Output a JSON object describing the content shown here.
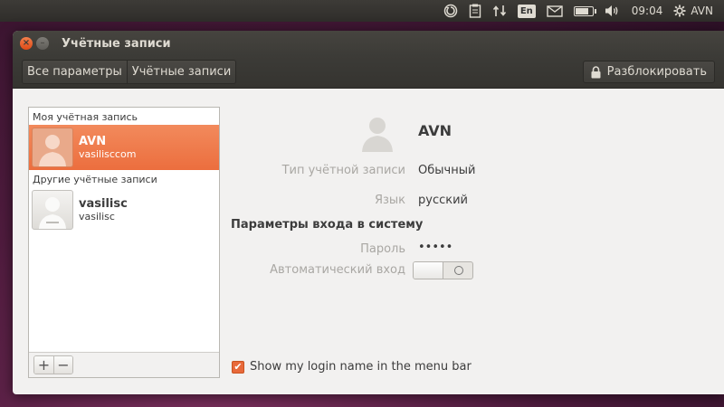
{
  "top_panel": {
    "lang": "En",
    "time": "09:04",
    "user": "AVN",
    "battery_level": 0.85
  },
  "window": {
    "title": "Учётные записи",
    "toolbar": {
      "breadcrumb_all": "Все параметры",
      "breadcrumb_current": "Учётные записи",
      "unlock_label": "Разблокировать"
    }
  },
  "account_list": {
    "my_header": "Моя учётная запись",
    "my_account": {
      "name": "AVN",
      "login": "vasilisccom"
    },
    "other_header": "Другие учётные записи",
    "other_accounts": [
      {
        "name": "vasilisc",
        "login": "vasilisc"
      }
    ],
    "add_label": "+",
    "remove_label": "−"
  },
  "details": {
    "name": "AVN",
    "account_type_label": "Тип учётной записи",
    "account_type_value": "Обычный",
    "language_label": "Язык",
    "language_value": "русский",
    "login_section": "Параметры входа в систему",
    "password_label": "Пароль",
    "password_value": "•••••",
    "autologin_label": "Автоматический вход",
    "autologin_on": false,
    "show_login_label": "Show my login name in the menu bar",
    "show_login_checked": true
  },
  "colors": {
    "accent": "#ec6e3e",
    "panel": "#3c3b37",
    "window_bg": "#f2f1f0"
  }
}
